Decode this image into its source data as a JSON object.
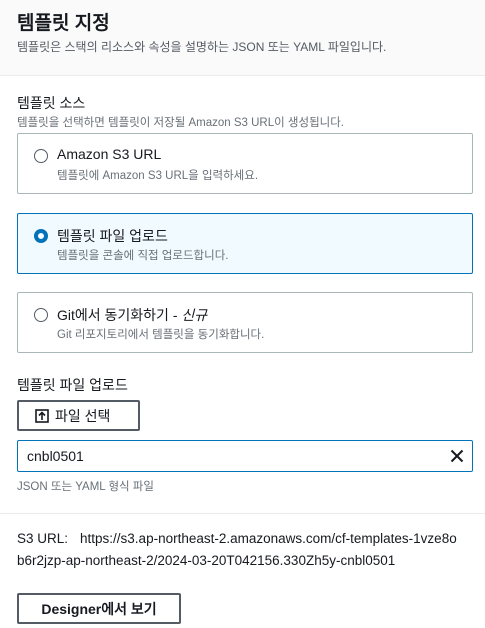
{
  "header": {
    "title": "템플릿 지정",
    "description": "템플릿은 스택의 리소스와 속성을 설명하는 JSON 또는 YAML 파일입니다."
  },
  "template_source": {
    "label": "템플릿 소스",
    "description": "템플릿을 선택하면 템플릿이 저장될 Amazon S3 URL이 생성됩니다.",
    "options": [
      {
        "title": "Amazon S3 URL",
        "description": "템플릿에 Amazon S3 URL을 입력하세요.",
        "selected": false
      },
      {
        "title": "템플릿 파일 업로드",
        "description": "템플릿을 콘솔에 직접 업로드합니다.",
        "selected": true
      },
      {
        "title": "Git에서 동기화하기 - ",
        "badge": "신규",
        "description": "Git 리포지토리에서 템플릿을 동기화합니다.",
        "selected": false
      }
    ]
  },
  "upload": {
    "label": "템플릿 파일 업로드",
    "choose_button": "파일 선택",
    "file_name": "cnbl0501",
    "hint": "JSON 또는 YAML 형식 파일"
  },
  "s3": {
    "label": "S3 URL:",
    "url": "https://s3.ap-northeast-2.amazonaws.com/cf-templates-1vze8ob6r2jzp-ap-northeast-2/2024-03-20T042156.330Zh5y-cnbl0501"
  },
  "designer_button": "Designer에서 보기",
  "colors": {
    "accent": "#0073bb",
    "selected_bg": "#f1faff",
    "text": "#16191f",
    "secondary_text": "#687078"
  },
  "icons": [
    "upload-icon",
    "clear-icon"
  ]
}
